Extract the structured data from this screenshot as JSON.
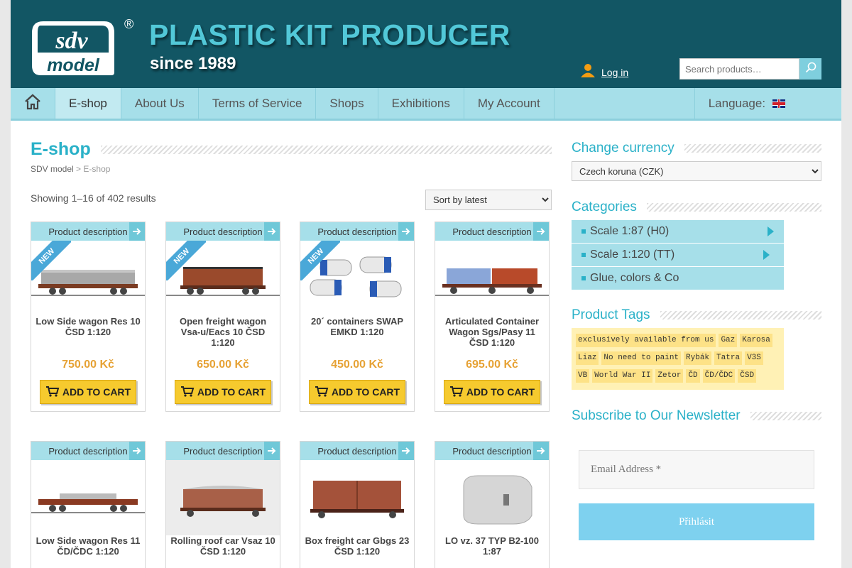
{
  "header": {
    "logo_text_top": "sdv",
    "logo_text_bottom": "model",
    "registered_mark": "®",
    "title": "PLASTIC KIT PRODUCER",
    "subtitle": "since 1989",
    "login_label": "Log in",
    "search_placeholder": "Search products…"
  },
  "nav": {
    "items": [
      "E-shop",
      "About Us",
      "Terms of Service",
      "Shops",
      "Exhibitions",
      "My Account"
    ],
    "active": "E-shop",
    "language_label": "Language:"
  },
  "main": {
    "title": "E-shop",
    "breadcrumb": {
      "home": "SDV model",
      "sep": ">",
      "current": "E-shop"
    },
    "showing": "Showing 1–16 of 402 results",
    "sort_selected": "Sort by latest",
    "product_label": "Product description",
    "new_badge": "NEW",
    "add_to_cart": "ADD TO CART",
    "products": [
      {
        "name": "Low Side wagon Res 10 ČSD 1:120",
        "price": "750.00 Kč",
        "is_new": true
      },
      {
        "name": "Open freight wagon Vsa-u/Eacs 10 ČSD 1:120",
        "price": "650.00 Kč",
        "is_new": true
      },
      {
        "name": "20´ containers SWAP EMKD 1:120",
        "price": "450.00 Kč",
        "is_new": true
      },
      {
        "name": "Articulated Container Wagon Sgs/Pasy 11 ČSD 1:120",
        "price": "695.00 Kč",
        "is_new": false
      },
      {
        "name": "Low Side wagon Res 11 ČD/ČDC 1:120",
        "is_new": false
      },
      {
        "name": "Rolling roof car Vsaz 10 ČSD 1:120",
        "is_new": false
      },
      {
        "name": "Box freight car Gbgs 23 ČSD 1:120",
        "is_new": false
      },
      {
        "name": "LO vz. 37 TYP B2-100 1:87",
        "is_new": false
      }
    ]
  },
  "sidebar": {
    "currency_title": "Change currency",
    "currency_selected": "Czech koruna (CZK)",
    "categories_title": "Categories",
    "categories": [
      {
        "label": "Scale 1:87 (H0)",
        "has_children": true
      },
      {
        "label": "Scale 1:120 (TT)",
        "has_children": true
      },
      {
        "label": "Glue, colors & Co",
        "has_children": false
      }
    ],
    "tags_title": "Product Tags",
    "tags": [
      "exclusively available from us",
      "Gaz",
      "Karosa",
      "Liaz",
      "No need to paint",
      "Rybák",
      "Tatra",
      "V3S",
      "VB",
      "World War II",
      "Zetor",
      "ČD",
      "ČD/ČDC",
      "ČSD"
    ],
    "newsletter_title": "Subscribe to Our Newsletter",
    "email_placeholder": "Email Address *",
    "subscribe_label": "Přihlásit"
  },
  "colors": {
    "header_bg": "#125664",
    "accent": "#2ab1c8",
    "nav_bg": "#a6dfe9",
    "price": "#e6a235",
    "cart_button": "#f6ca2e",
    "subscribe_button": "#7ed1ef"
  }
}
